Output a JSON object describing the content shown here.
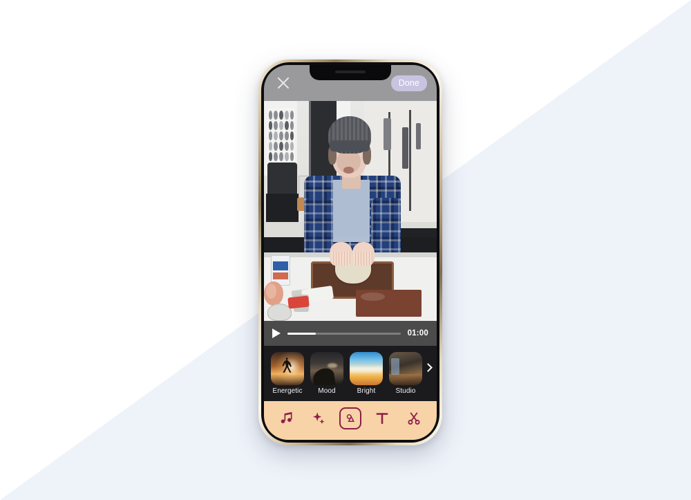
{
  "background": {
    "top_color": "#ffffff",
    "bottom_color": "#eef2f9"
  },
  "device": {
    "name": "smartphone-mockup",
    "frame_color": "#cbb790",
    "bezel_color": "#0d0d0f"
  },
  "app": {
    "topbar": {
      "background": "#9a9a9c",
      "close_icon": "close-icon",
      "done_label": "Done",
      "done_bg": "#c7c3e0",
      "done_text_color": "#ffffff"
    },
    "video": {
      "description": "Person in gray knit beanie and blue plaid shirt mixing ingredients in a glass bowl on a kitchen counter",
      "alt": "cooking video preview"
    },
    "player": {
      "background": "#4b4b4b",
      "play_icon": "play-icon",
      "progress_percent": 25,
      "time_label": "01:00",
      "fill_color": "#ffffff",
      "track_color": "#7d7d7d"
    },
    "filters": {
      "background": "#1b1b1e",
      "next_icon": "chevron-right-icon",
      "items": [
        {
          "label": "Energetic",
          "thumb": "fx-energetic"
        },
        {
          "label": "Mood",
          "thumb": "fx-mood"
        },
        {
          "label": "Bright",
          "thumb": "fx-bright"
        },
        {
          "label": "Studio",
          "thumb": "fx-studio"
        }
      ]
    },
    "toolbar": {
      "background": "#f7d3a7",
      "icon_color": "#8c1f47",
      "items": [
        {
          "name": "music-icon",
          "label": "Music",
          "selected": false
        },
        {
          "name": "sparkles-icon",
          "label": "Effects",
          "selected": false
        },
        {
          "name": "filter-icon",
          "label": "Filters",
          "selected": true
        },
        {
          "name": "text-icon",
          "label": "Text",
          "selected": false
        },
        {
          "name": "scissors-icon",
          "label": "Trim",
          "selected": false
        }
      ]
    }
  }
}
